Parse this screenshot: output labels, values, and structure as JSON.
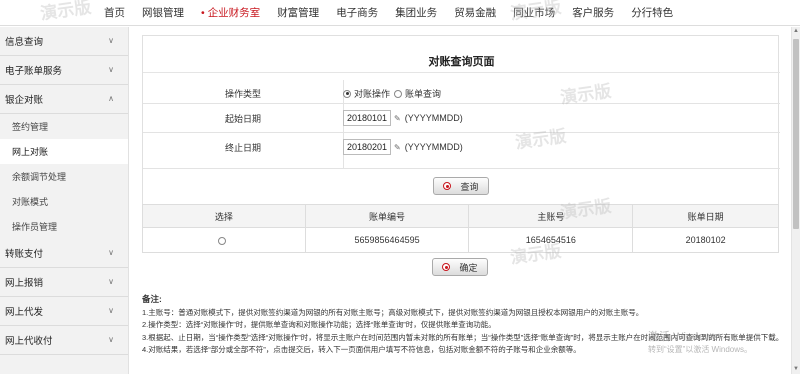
{
  "topnav": {
    "items": [
      "首页",
      "网银管理",
      "企业财务室",
      "财富管理",
      "电子商务",
      "集团业务",
      "贸易金融",
      "同业市场",
      "客户服务",
      "分行特色"
    ],
    "active_index": 2,
    "accent_color": "#c8161e"
  },
  "sidebar": {
    "groups": [
      {
        "label": "信息查询"
      },
      {
        "label": "电子账单服务"
      },
      {
        "label": "银企对账",
        "expanded": true
      }
    ],
    "sub_items": [
      "签约管理",
      "网上对账",
      "余额调节处理",
      "对账模式",
      "操作员管理"
    ],
    "active_sub": "网上对账",
    "groups_after": [
      "转账支付",
      "网上报销",
      "网上代发",
      "网上代收付"
    ]
  },
  "form": {
    "title": "对账查询页面",
    "op_type_label": "操作类型",
    "radio_reconcile": "对账操作",
    "radio_bill_query": "账单查询",
    "start_date_label": "起始日期",
    "start_date_value": "20180101",
    "end_date_label": "终止日期",
    "end_date_value": "20180201",
    "date_format": "(YYYYMMDD)",
    "query_button": "查询"
  },
  "result_table": {
    "headers": [
      "选择",
      "账单编号",
      "主账号",
      "账单日期"
    ],
    "rows": [
      {
        "bill_no": "5659856464595",
        "account": "1654654516",
        "date": "20180102"
      }
    ],
    "confirm_button": "确定"
  },
  "notes": {
    "title": "备注:",
    "lines": [
      "1.主账号：普通对账模式下，提供对账签约渠道为网银的所有对账主账号；高级对账模式下，提供对账签约渠道为网银且授权本网银用户的对账主账号。",
      "2.操作类型：选择“对账操作”时，提供账单查询和对账操作功能；选择“账单查询”时，仅提供账单查询功能。",
      "3.根据起、止日期，当“操作类型”选择“对账操作”时，将显示主账户在时间范围内暂未对账的所有账单；当“操作类型”选择“账单查询”时，将显示主账户在时间范围内可查询到的所有账单提供下载。",
      "4.对账结果，若选择“部分或全部不符”，点击提交后，转入下一页面供用户填写不符信息，包括对账金额不符的子账号和企业余额等。"
    ]
  },
  "overlay": {
    "watermark": "演示版",
    "windows_line1": "激活 Windows",
    "windows_line2": "转到“设置”以激活 Windows。"
  }
}
